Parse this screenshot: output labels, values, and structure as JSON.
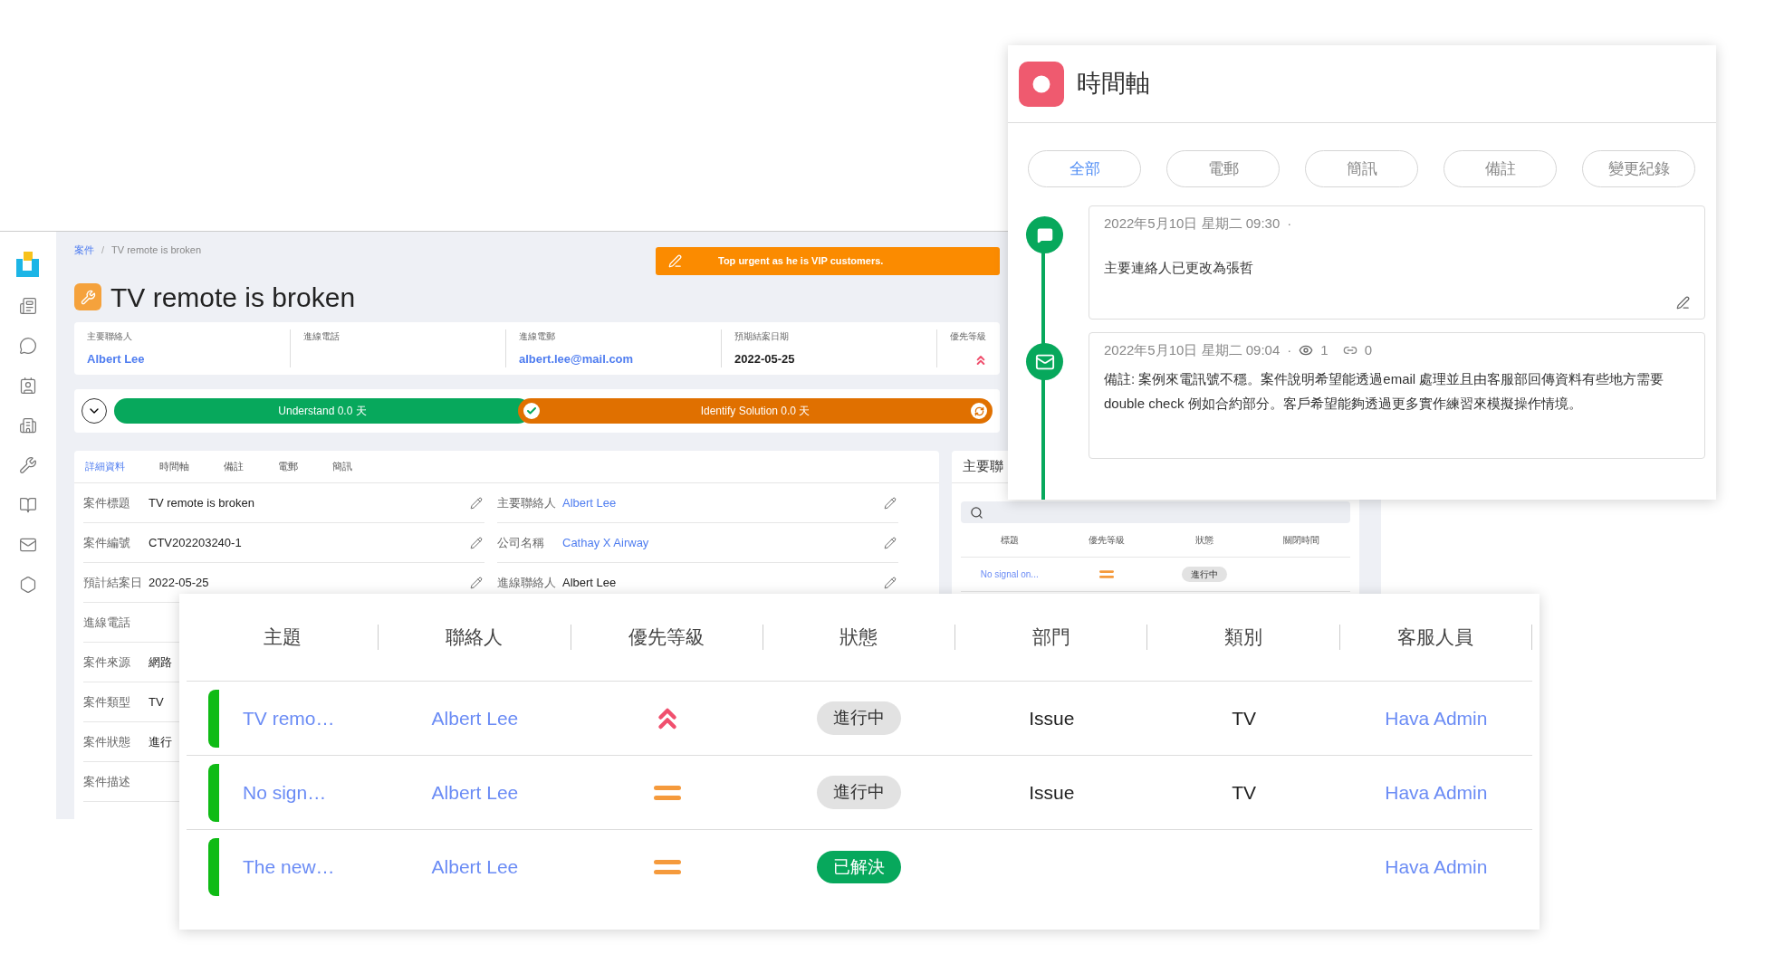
{
  "main": {
    "breadcrumb": [
      {
        "label": "案件",
        "kind": "link"
      },
      {
        "label": "TV remote is broken",
        "kind": "current"
      }
    ],
    "breadcrumb_separator": "/",
    "alert": "Top urgent as he is VIP customers.",
    "title": "TV remote is broken",
    "summary": [
      {
        "label": "主要聯絡人",
        "value": "Albert Lee",
        "kind": "link"
      },
      {
        "label": "進線電話",
        "kind": "empty"
      },
      {
        "label": "進線電郵",
        "value": "albert.lee@mail.com",
        "kind": "link"
      },
      {
        "label": "預期結案日期",
        "value": "2022-05-25",
        "kind": "text"
      },
      {
        "label": "優先等級",
        "kind": "priority",
        "priority": {
          "kind": "high"
        }
      }
    ],
    "progress": [
      {
        "label": "Understand 0.0 天",
        "kind": "done"
      },
      {
        "label": "Identify Solution 0.0 天",
        "kind": "current"
      }
    ],
    "tabs": [
      {
        "label": "詳細資料",
        "selected": true
      },
      {
        "label": "時間軸",
        "selected": false
      },
      {
        "label": "備註",
        "selected": false
      },
      {
        "label": "電郵",
        "selected": false
      },
      {
        "label": "簡訊",
        "selected": false
      }
    ],
    "fields": [
      {
        "left": {
          "label": "案件標題",
          "value": "TV remote is broken",
          "kind": "text"
        },
        "right": {
          "label": "主要聯絡人",
          "value": "Albert Lee",
          "kind": "link"
        }
      },
      {
        "left": {
          "label": "案件編號",
          "value": "CTV202203240-1",
          "kind": "text"
        },
        "right": {
          "label": "公司名稱",
          "value": "Cathay X Airway",
          "kind": "link"
        }
      },
      {
        "left": {
          "label": "預計結案日",
          "value": "2022-05-25",
          "kind": "text"
        },
        "right": {
          "label": "進線聯絡人",
          "value": "Albert Lee",
          "kind": "text"
        }
      },
      {
        "left": {
          "label": "進線電話"
        }
      },
      {
        "left": {
          "label": "案件來源",
          "value": "網路",
          "kind": "text"
        }
      },
      {
        "left": {
          "label": "案件類型",
          "value": "TV",
          "kind": "text"
        }
      },
      {
        "left": {
          "label": "案件狀態",
          "value": "進行",
          "kind": "text"
        }
      },
      {
        "left": {
          "label": "案件描述"
        }
      }
    ],
    "related": {
      "title": "主要聯",
      "columns": [
        "標題",
        "優先等級",
        "狀態",
        "關閉時間"
      ],
      "rows": [
        {
          "title": "No signal on...",
          "priority": {
            "kind": "medium"
          },
          "status": {
            "label": "進行中",
            "kind": "in_progress"
          }
        }
      ]
    }
  },
  "timeline": {
    "title": "時間軸",
    "filters": [
      {
        "label": "全部",
        "selected": true
      },
      {
        "label": "電郵",
        "selected": false
      },
      {
        "label": "簡訊",
        "selected": false
      },
      {
        "label": "備註",
        "selected": false
      },
      {
        "label": "變更紀錄",
        "selected": false
      }
    ],
    "entries": [
      {
        "kind": "note",
        "time": "2022年5月10日 星期二 09:30",
        "separator": "·",
        "text": "主要連絡人已更改為張哲"
      },
      {
        "kind": "mail",
        "time": "2022年5月10日 星期二 09:04",
        "separator": "·",
        "views": "1",
        "links": "0",
        "text": "備註: 案例來電訊號不穩。案件說明希望能透過email 處理並且由客服部回傳資料有些地方需要double check 例如合約部分。客戶希望能夠透過更多實作練習來模擬操作情境。"
      }
    ]
  },
  "cases_table": {
    "columns": [
      "主題",
      "聯絡人",
      "優先等級",
      "狀態",
      "部門",
      "類別",
      "客服人員"
    ],
    "rows": [
      {
        "subject": "TV remo…",
        "contact": "Albert Lee",
        "priority": {
          "kind": "high"
        },
        "status": {
          "label": "進行中",
          "kind": "in_progress"
        },
        "department": "Issue",
        "category": "TV",
        "agent": "Hava Admin"
      },
      {
        "subject": "No sign…",
        "contact": "Albert Lee",
        "priority": {
          "kind": "medium"
        },
        "status": {
          "label": "進行中",
          "kind": "in_progress"
        },
        "department": "Issue",
        "category": "TV",
        "agent": "Hava Admin"
      },
      {
        "subject": "The new…",
        "contact": "Albert Lee",
        "priority": {
          "kind": "medium"
        },
        "status": {
          "label": "已解決",
          "kind": "resolved"
        },
        "agent": "Hava Admin"
      }
    ]
  }
}
